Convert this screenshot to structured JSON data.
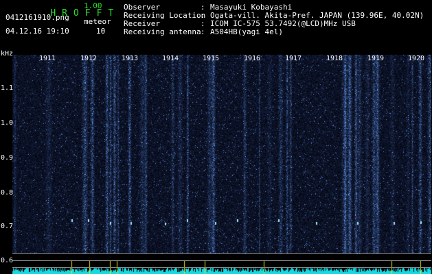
{
  "app": {
    "title_letters": [
      "H",
      "R",
      "O",
      "F",
      "F",
      "T"
    ],
    "version": "1.00",
    "filename": "0412161910.png",
    "meteor_label": "meteor",
    "datetime": "04.12.16 19:10",
    "meteor_count": "10"
  },
  "station": {
    "observer_label": "Observer",
    "observer_value": "Masayuki Kobayashi",
    "location_label": "Receiving Location",
    "location_value": "Ogata-vill. Akita-Pref. JAPAN (139.96E, 40.02N)",
    "receiver_label": "Receiver",
    "receiver_value": "ICOM IC-575 53.7492(@LCD)MHz USB",
    "antenna_label": "Receiving antenna",
    "antenna_value": "A504HB(yagi 4el)",
    "colon": ":"
  },
  "axis": {
    "unit": "kHz",
    "y_ticks": [
      "1.1",
      "1.0",
      "0.9",
      "0.8",
      "0.7",
      "0.6"
    ],
    "minutes": [
      "1911",
      "1912",
      "1913",
      "1914",
      "1915",
      "1916",
      "1917",
      "1918",
      "1919",
      "1920"
    ]
  },
  "colors": {
    "background": "#000000",
    "header_green": "#2ee02e",
    "signal_blue": "#3a5cff",
    "meteor_cyan": "#9fe8ff",
    "noise_floor": "#19d8e0",
    "marker_yellow": "#e6e600"
  }
}
